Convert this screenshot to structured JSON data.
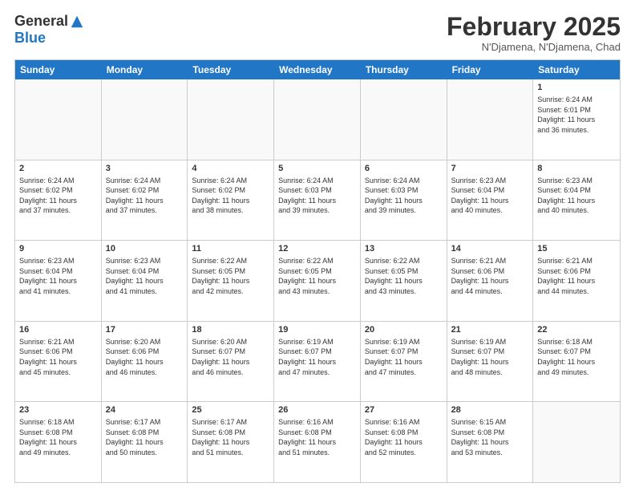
{
  "logo": {
    "general": "General",
    "blue": "Blue"
  },
  "title": "February 2025",
  "location": "N'Djamena, N'Djamena, Chad",
  "days_of_week": [
    "Sunday",
    "Monday",
    "Tuesday",
    "Wednesday",
    "Thursday",
    "Friday",
    "Saturday"
  ],
  "weeks": [
    [
      {
        "day": "",
        "info": ""
      },
      {
        "day": "",
        "info": ""
      },
      {
        "day": "",
        "info": ""
      },
      {
        "day": "",
        "info": ""
      },
      {
        "day": "",
        "info": ""
      },
      {
        "day": "",
        "info": ""
      },
      {
        "day": "1",
        "info": "Sunrise: 6:24 AM\nSunset: 6:01 PM\nDaylight: 11 hours\nand 36 minutes."
      }
    ],
    [
      {
        "day": "2",
        "info": "Sunrise: 6:24 AM\nSunset: 6:02 PM\nDaylight: 11 hours\nand 37 minutes."
      },
      {
        "day": "3",
        "info": "Sunrise: 6:24 AM\nSunset: 6:02 PM\nDaylight: 11 hours\nand 37 minutes."
      },
      {
        "day": "4",
        "info": "Sunrise: 6:24 AM\nSunset: 6:02 PM\nDaylight: 11 hours\nand 38 minutes."
      },
      {
        "day": "5",
        "info": "Sunrise: 6:24 AM\nSunset: 6:03 PM\nDaylight: 11 hours\nand 39 minutes."
      },
      {
        "day": "6",
        "info": "Sunrise: 6:24 AM\nSunset: 6:03 PM\nDaylight: 11 hours\nand 39 minutes."
      },
      {
        "day": "7",
        "info": "Sunrise: 6:23 AM\nSunset: 6:04 PM\nDaylight: 11 hours\nand 40 minutes."
      },
      {
        "day": "8",
        "info": "Sunrise: 6:23 AM\nSunset: 6:04 PM\nDaylight: 11 hours\nand 40 minutes."
      }
    ],
    [
      {
        "day": "9",
        "info": "Sunrise: 6:23 AM\nSunset: 6:04 PM\nDaylight: 11 hours\nand 41 minutes."
      },
      {
        "day": "10",
        "info": "Sunrise: 6:23 AM\nSunset: 6:04 PM\nDaylight: 11 hours\nand 41 minutes."
      },
      {
        "day": "11",
        "info": "Sunrise: 6:22 AM\nSunset: 6:05 PM\nDaylight: 11 hours\nand 42 minutes."
      },
      {
        "day": "12",
        "info": "Sunrise: 6:22 AM\nSunset: 6:05 PM\nDaylight: 11 hours\nand 43 minutes."
      },
      {
        "day": "13",
        "info": "Sunrise: 6:22 AM\nSunset: 6:05 PM\nDaylight: 11 hours\nand 43 minutes."
      },
      {
        "day": "14",
        "info": "Sunrise: 6:21 AM\nSunset: 6:06 PM\nDaylight: 11 hours\nand 44 minutes."
      },
      {
        "day": "15",
        "info": "Sunrise: 6:21 AM\nSunset: 6:06 PM\nDaylight: 11 hours\nand 44 minutes."
      }
    ],
    [
      {
        "day": "16",
        "info": "Sunrise: 6:21 AM\nSunset: 6:06 PM\nDaylight: 11 hours\nand 45 minutes."
      },
      {
        "day": "17",
        "info": "Sunrise: 6:20 AM\nSunset: 6:06 PM\nDaylight: 11 hours\nand 46 minutes."
      },
      {
        "day": "18",
        "info": "Sunrise: 6:20 AM\nSunset: 6:07 PM\nDaylight: 11 hours\nand 46 minutes."
      },
      {
        "day": "19",
        "info": "Sunrise: 6:19 AM\nSunset: 6:07 PM\nDaylight: 11 hours\nand 47 minutes."
      },
      {
        "day": "20",
        "info": "Sunrise: 6:19 AM\nSunset: 6:07 PM\nDaylight: 11 hours\nand 47 minutes."
      },
      {
        "day": "21",
        "info": "Sunrise: 6:19 AM\nSunset: 6:07 PM\nDaylight: 11 hours\nand 48 minutes."
      },
      {
        "day": "22",
        "info": "Sunrise: 6:18 AM\nSunset: 6:07 PM\nDaylight: 11 hours\nand 49 minutes."
      }
    ],
    [
      {
        "day": "23",
        "info": "Sunrise: 6:18 AM\nSunset: 6:08 PM\nDaylight: 11 hours\nand 49 minutes."
      },
      {
        "day": "24",
        "info": "Sunrise: 6:17 AM\nSunset: 6:08 PM\nDaylight: 11 hours\nand 50 minutes."
      },
      {
        "day": "25",
        "info": "Sunrise: 6:17 AM\nSunset: 6:08 PM\nDaylight: 11 hours\nand 51 minutes."
      },
      {
        "day": "26",
        "info": "Sunrise: 6:16 AM\nSunset: 6:08 PM\nDaylight: 11 hours\nand 51 minutes."
      },
      {
        "day": "27",
        "info": "Sunrise: 6:16 AM\nSunset: 6:08 PM\nDaylight: 11 hours\nand 52 minutes."
      },
      {
        "day": "28",
        "info": "Sunrise: 6:15 AM\nSunset: 6:08 PM\nDaylight: 11 hours\nand 53 minutes."
      },
      {
        "day": "",
        "info": ""
      }
    ]
  ]
}
